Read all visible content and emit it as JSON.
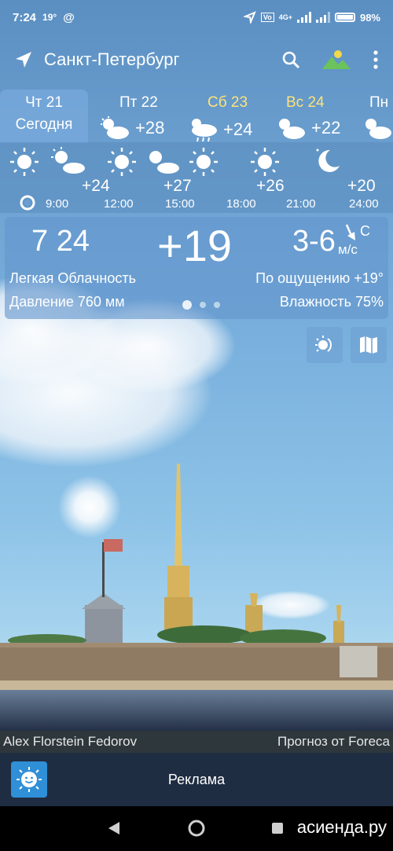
{
  "status": {
    "time": "7:24",
    "temp": "19°",
    "at": "@",
    "battery": "98%"
  },
  "app_bar": {
    "city": "Санкт-Петербург",
    "location_icon": "location-arrow-icon",
    "search_icon": "search-icon",
    "background_icon": "landscape-icon",
    "menu_icon": "more-vert-icon"
  },
  "days": [
    {
      "name": "Чт 21",
      "sub": "Сегодня",
      "temp": "",
      "icon": ""
    },
    {
      "name": "Пт 22",
      "sub": "",
      "temp": "+28",
      "icon": "sun-cloud-icon"
    },
    {
      "name": "Сб 23",
      "sub": "",
      "temp": "+24",
      "icon": "sun-rain-cloud-icon"
    },
    {
      "name": "Вс 24",
      "sub": "",
      "temp": "+22",
      "icon": "sun-cloud-icon"
    },
    {
      "name": "Пн",
      "sub": "",
      "temp": "",
      "icon": "sun-cloud-icon"
    }
  ],
  "hourly": {
    "times": [
      "9:00",
      "12:00",
      "15:00",
      "18:00",
      "21:00",
      "24:00"
    ],
    "temps": [
      "+24",
      "+27",
      "+26",
      "+20"
    ]
  },
  "current": {
    "time": "7 24",
    "temp": "+19",
    "wind_speed": "3-6",
    "wind_direction": "С",
    "wind_unit": "м/с",
    "condition": "Легкая Облачность",
    "feels_like": "По ощущению +19°",
    "pressure": "Давление 760 мм",
    "humidity": "Влажность 75%"
  },
  "pager": {
    "pages": 3,
    "active": 0
  },
  "credits": {
    "photo": "Alex Florstein Fedorov",
    "forecast": "Прогноз от Foreca"
  },
  "ad": {
    "label": "Реклама"
  },
  "watermark": "асиенда.ру",
  "colors": {
    "accent_yellow": "#ffe27a",
    "ad_bar": "#1f2d42",
    "logo_blue": "#2f8fd7"
  }
}
